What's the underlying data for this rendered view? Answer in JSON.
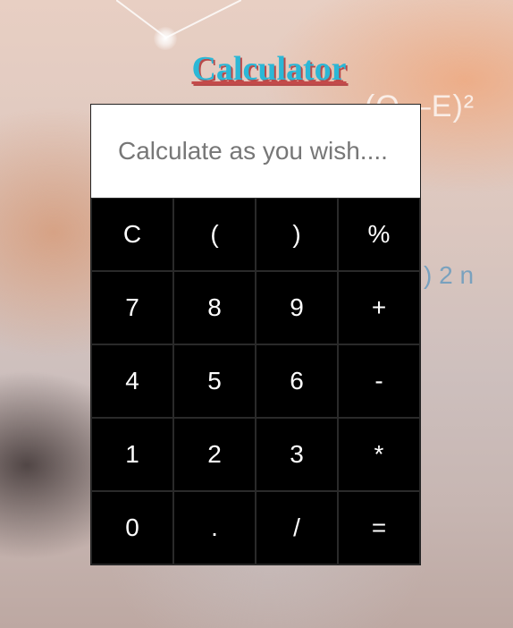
{
  "title": "Calculator",
  "display": {
    "value": "",
    "placeholder": "Calculate as you wish...."
  },
  "background": {
    "formula_top": "(O—E)²",
    "formula_side": ") 2 n"
  },
  "keys": [
    {
      "label": "C",
      "name": "clear-button"
    },
    {
      "label": "(",
      "name": "open-paren-button"
    },
    {
      "label": ")",
      "name": "close-paren-button"
    },
    {
      "label": "%",
      "name": "percent-button"
    },
    {
      "label": "7",
      "name": "digit-7-button"
    },
    {
      "label": "8",
      "name": "digit-8-button"
    },
    {
      "label": "9",
      "name": "digit-9-button"
    },
    {
      "label": "+",
      "name": "add-button"
    },
    {
      "label": "4",
      "name": "digit-4-button"
    },
    {
      "label": "5",
      "name": "digit-5-button"
    },
    {
      "label": "6",
      "name": "digit-6-button"
    },
    {
      "label": "-",
      "name": "subtract-button"
    },
    {
      "label": "1",
      "name": "digit-1-button"
    },
    {
      "label": "2",
      "name": "digit-2-button"
    },
    {
      "label": "3",
      "name": "digit-3-button"
    },
    {
      "label": "*",
      "name": "multiply-button"
    },
    {
      "label": "0",
      "name": "digit-0-button"
    },
    {
      "label": ".",
      "name": "decimal-button"
    },
    {
      "label": "/",
      "name": "divide-button"
    },
    {
      "label": "=",
      "name": "equals-button"
    }
  ],
  "colors": {
    "title": "#2bb7d6",
    "title_shadow": "#b84a4a",
    "keypad_bg": "#000000",
    "key_text": "#ffffff",
    "display_bg": "#ffffff"
  }
}
